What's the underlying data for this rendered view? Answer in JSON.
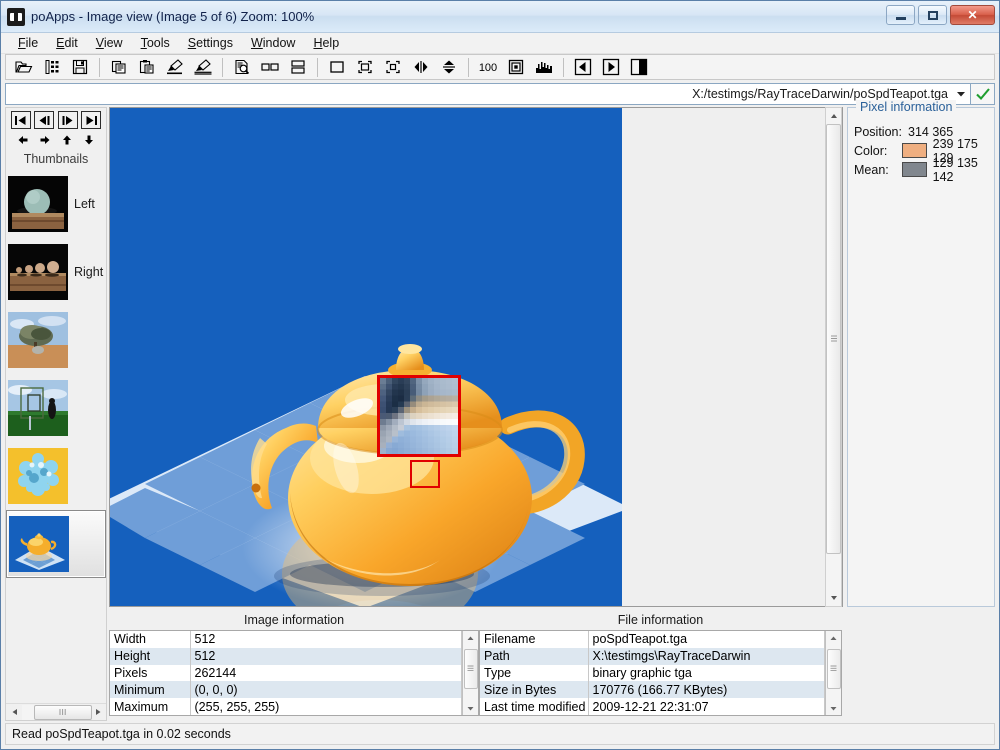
{
  "window": {
    "title": "poApps - Image view (Image 5 of 6) Zoom: 100%",
    "icon": "app-icon",
    "minimize_label": "",
    "maximize_label": "",
    "close_label": "✕"
  },
  "menu": {
    "items": [
      {
        "label": "File",
        "mnemonic": "F"
      },
      {
        "label": "Edit",
        "mnemonic": "E"
      },
      {
        "label": "View",
        "mnemonic": "V"
      },
      {
        "label": "Tools",
        "mnemonic": "T"
      },
      {
        "label": "Settings",
        "mnemonic": "S"
      },
      {
        "label": "Window",
        "mnemonic": "W"
      },
      {
        "label": "Help",
        "mnemonic": "H"
      }
    ]
  },
  "toolbar": {
    "groups": [
      [
        "open-folder-icon",
        "filmstrip-icon",
        "save-icon"
      ],
      [
        "copy-icon",
        "paste-icon",
        "brush-icon",
        "brush-wide-icon"
      ],
      [
        "preview-document-icon",
        "two-pane-horizontal-icon",
        "two-pane-vertical-icon"
      ],
      [
        "rectangle-select-icon",
        "fit-image-icon",
        "crop-icon",
        "flip-horizontal-icon",
        "flip-vertical-icon"
      ],
      [
        "zoom-100-icon",
        "zoom-fit-icon",
        "histogram-icon"
      ],
      [
        "previous-image-icon",
        "next-image-icon",
        "split-view-icon"
      ]
    ]
  },
  "pathbar": {
    "value": "X:/testimgs/RayTraceDarwin/poSpdTeapot.tga",
    "placeholder": "",
    "dropdown_icon": "chevron-down-icon",
    "confirm_icon": "check-icon",
    "confirm_color": "#1f9e2f"
  },
  "thumbnails": {
    "title": "Thumbnails",
    "nav_buttons": [
      {
        "name": "first-image-button",
        "icon": "skip-to-start-icon"
      },
      {
        "name": "previous-image-button",
        "icon": "step-back-icon"
      },
      {
        "name": "next-image-button",
        "icon": "step-forward-icon"
      },
      {
        "name": "last-image-button",
        "icon": "skip-to-end-icon"
      }
    ],
    "arrow_buttons": [
      {
        "name": "scroll-left-button",
        "icon": "arrow-left-icon"
      },
      {
        "name": "scroll-right-button",
        "icon": "arrow-right-icon"
      },
      {
        "name": "scroll-up-button",
        "icon": "arrow-up-icon"
      },
      {
        "name": "scroll-down-button",
        "icon": "arrow-down-icon"
      }
    ],
    "items": [
      {
        "label": "Left",
        "selected": false,
        "scene": "sphere-on-table"
      },
      {
        "label": "Right",
        "selected": false,
        "scene": "spheres-row"
      },
      {
        "label": "",
        "selected": false,
        "scene": "tree-on-sand"
      },
      {
        "label": "",
        "selected": false,
        "scene": "green-field-frames"
      },
      {
        "label": "",
        "selected": false,
        "scene": "blue-crystal-on-gold"
      },
      {
        "label": "",
        "selected": true,
        "scene": "teapot-on-checker"
      }
    ],
    "hscroll_left_icon": "arrow-left-icon",
    "hscroll_right_icon": "arrow-right-icon"
  },
  "image_view": {
    "background_color": "#1560bd",
    "scene": "orange-teapot-on-blue-checkerboard",
    "magnifier": {
      "border_color": "#e00000",
      "source_box_color": "#e00000"
    },
    "vscroll": {
      "up_icon": "arrow-up-icon",
      "down_icon": "arrow-down-icon"
    }
  },
  "pixel_information": {
    "legend": "Pixel information",
    "legend_color": "#2a6099",
    "rows": [
      {
        "label": "Position:",
        "value": "314   365",
        "swatch": null
      },
      {
        "label": "Color:",
        "value": "239 175 129",
        "swatch": "#efaf81"
      },
      {
        "label": "Mean:",
        "value": "129 135 142",
        "swatch": "#81878e"
      }
    ]
  },
  "image_information": {
    "title": "Image information",
    "rows": [
      {
        "key": "Width",
        "value": "512"
      },
      {
        "key": "Height",
        "value": "512"
      },
      {
        "key": "Pixels",
        "value": "262144"
      },
      {
        "key": "Minimum",
        "value": "(0, 0, 0)"
      },
      {
        "key": "Maximum",
        "value": "(255, 255, 255)"
      }
    ]
  },
  "file_information": {
    "title": "File information",
    "rows": [
      {
        "key": "Filename",
        "value": "poSpdTeapot.tga"
      },
      {
        "key": "Path",
        "value": "X:\\testimgs\\RayTraceDarwin"
      },
      {
        "key": "Type",
        "value": "binary graphic tga"
      },
      {
        "key": "Size in Bytes",
        "value": "170776 (166.77 KBytes)"
      },
      {
        "key": "Last time modified",
        "value": "2009-12-21 22:31:07"
      }
    ]
  },
  "statusbar": {
    "message": "Read poSpdTeapot.tga in 0.02 seconds"
  }
}
